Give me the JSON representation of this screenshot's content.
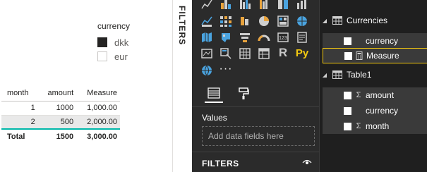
{
  "slicer": {
    "title": "currency",
    "items": [
      {
        "label": "dkk",
        "checked": true
      },
      {
        "label": "eur",
        "checked": false
      }
    ]
  },
  "table": {
    "headers": [
      "month",
      "amount",
      "Measure"
    ],
    "rows": [
      [
        "1",
        "1000",
        "1,000.00"
      ],
      [
        "2",
        "500",
        "2,000.00"
      ]
    ],
    "total": [
      "Total",
      "1500",
      "3,000.00"
    ],
    "accent_color": "#01b8aa"
  },
  "filters_strip": {
    "label": "FILTERS"
  },
  "visualizations": {
    "icons": [
      "stacked-bar-icon",
      "clustered-column-icon",
      "stacked-bar-100-icon",
      "clustered-bar-icon",
      "column-100-icon",
      "line-column-icon",
      "ribbon-icon",
      "waterfall-icon",
      "scatter-icon",
      "pie-icon",
      "donut-icon",
      "treemap-icon",
      "map-icon",
      "filled-map-icon",
      "funnel-icon",
      "gauge-icon",
      "card-icon",
      "multirow-card-icon",
      "kpi-icon",
      "slicer-icon",
      "table-icon",
      "matrix-icon",
      "r-visual-icon",
      "python-visual-icon",
      "globe-icon",
      "more-icon"
    ],
    "r_label": "R",
    "py_label": "Py",
    "more_label": "···",
    "values_label": "Values",
    "drop_placeholder": "Add data fields here",
    "filters_label": "FILTERS"
  },
  "fields": {
    "tables": [
      {
        "name": "Currencies",
        "fields": [
          {
            "name": "currency",
            "type": "text"
          },
          {
            "name": "Measure",
            "type": "measure",
            "selected": true
          }
        ]
      },
      {
        "name": "Table1",
        "fields": [
          {
            "name": "amount",
            "type": "sum"
          },
          {
            "name": "currency",
            "type": "text"
          },
          {
            "name": "month",
            "type": "sum"
          }
        ]
      }
    ]
  }
}
